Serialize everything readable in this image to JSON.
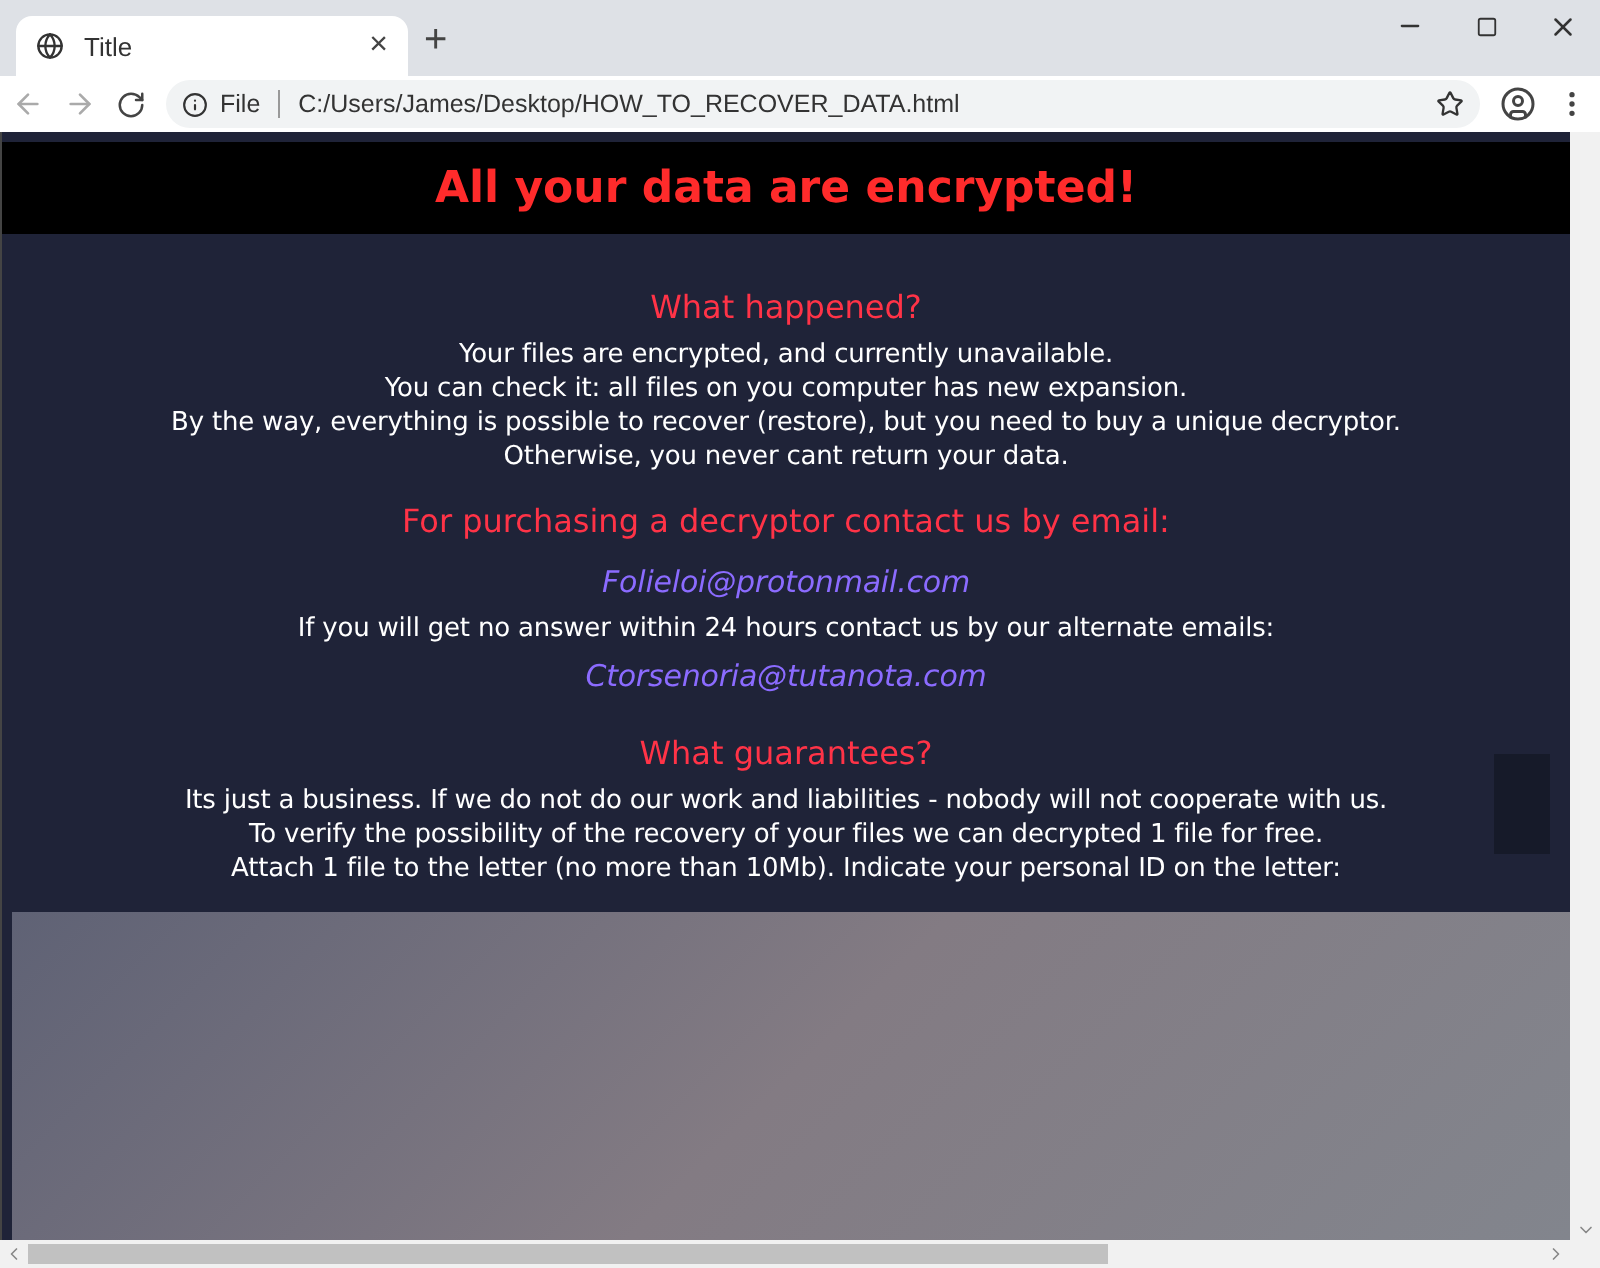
{
  "browser": {
    "tab": {
      "title": "Title",
      "close": "×"
    },
    "new_tab": "+",
    "address_bar": {
      "scheme": "File",
      "url": "C:/Users/James/Desktop/HOW_TO_RECOVER_DATA.html"
    }
  },
  "page": {
    "heading": "All your data are encrypted!",
    "sections": [
      {
        "title": "What happened?",
        "lines": [
          {
            "kind": "text",
            "text": "Your files are encrypted, and currently unavailable."
          },
          {
            "kind": "text",
            "text": "You can check it: all files on you computer has new expansion."
          },
          {
            "kind": "text",
            "text": "By the way, everything is possible to recover (restore), but you need to buy a unique decryptor."
          },
          {
            "kind": "text",
            "text": "Otherwise, you never cant return your data."
          }
        ]
      },
      {
        "title": "For purchasing a decryptor contact us by email:",
        "lines": [
          {
            "kind": "email",
            "text": "Folieloi@protonmail.com"
          },
          {
            "kind": "text",
            "text": "If you will get no answer within 24 hours contact us by our alternate emails:"
          },
          {
            "kind": "email",
            "text": "Ctorsenoria@tutanota.com"
          }
        ]
      },
      {
        "title": "What guarantees?",
        "lines": [
          {
            "kind": "text",
            "text": "Its just a business. If we do not do our work and liabilities - nobody will not cooperate with us."
          },
          {
            "kind": "text",
            "text": "To verify the possibility of the recovery of your files we can decrypted 1 file for free."
          },
          {
            "kind": "text",
            "text": "Attach 1 file to the letter (no more than 10Mb). Indicate your personal ID on the letter:"
          }
        ]
      }
    ]
  }
}
